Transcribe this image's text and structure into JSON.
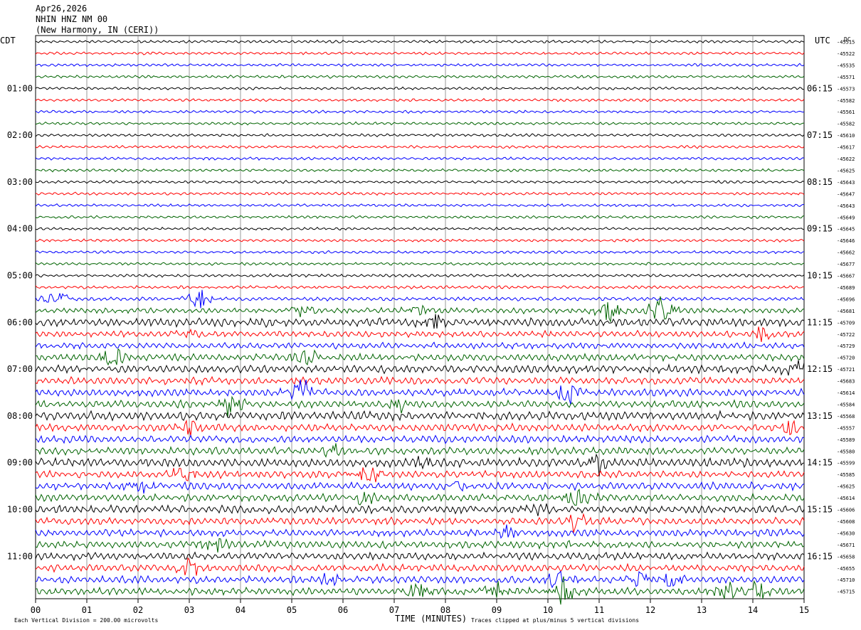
{
  "header": {
    "date": "Apr26,2026",
    "station": "NHIN HNZ NM 00",
    "location": "(New Harmony, IN (CERI))"
  },
  "left_timezone": "CDT",
  "right_timezone": "UTC",
  "corner_tag": "DC",
  "footer": {
    "scale_note": "Each Vertical Division =  200.00 microvolts",
    "xlabel": "TIME (MINUTES)",
    "clip_note": "Traces clipped at plus/minus 5 vertical divisions"
  },
  "colors": {
    "cycle": [
      "#000000",
      "#ff0000",
      "#0000ff",
      "#006400"
    ],
    "grid": "#808080"
  },
  "chart_data": {
    "type": "helicorder",
    "xlabel": "TIME (MINUTES)",
    "xlim": [
      0,
      15
    ],
    "x_ticks": [
      "00",
      "01",
      "02",
      "03",
      "04",
      "05",
      "06",
      "07",
      "08",
      "09",
      "10",
      "11",
      "12",
      "13",
      "14",
      "15"
    ],
    "grid": true,
    "row_minutes": 15,
    "row_count": 48,
    "left_hour_labels": [
      {
        "row": 4,
        "label": "01:00"
      },
      {
        "row": 8,
        "label": "02:00"
      },
      {
        "row": 12,
        "label": "03:00"
      },
      {
        "row": 16,
        "label": "04:00"
      },
      {
        "row": 20,
        "label": "05:00"
      },
      {
        "row": 24,
        "label": "06:00"
      },
      {
        "row": 28,
        "label": "07:00"
      },
      {
        "row": 32,
        "label": "08:00"
      },
      {
        "row": 36,
        "label": "09:00"
      },
      {
        "row": 40,
        "label": "10:00"
      },
      {
        "row": 44,
        "label": "11:00"
      }
    ],
    "right_hour_labels": [
      {
        "row": 4,
        "label": "06:15"
      },
      {
        "row": 8,
        "label": "07:15"
      },
      {
        "row": 12,
        "label": "08:15"
      },
      {
        "row": 16,
        "label": "09:15"
      },
      {
        "row": 20,
        "label": "10:15"
      },
      {
        "row": 24,
        "label": "11:15"
      },
      {
        "row": 28,
        "label": "12:15"
      },
      {
        "row": 32,
        "label": "13:15"
      },
      {
        "row": 36,
        "label": "14:15"
      },
      {
        "row": 40,
        "label": "15:15"
      },
      {
        "row": 44,
        "label": "16:15"
      }
    ],
    "row_offsets": [
      "-45515",
      "-45522",
      "-45535",
      "-45571",
      "-45573",
      "-45582",
      "-45561",
      "-45582",
      "-45610",
      "-45617",
      "-45622",
      "-45625",
      "-45643",
      "-45647",
      "-45643",
      "-45649",
      "-45645",
      "-45646",
      "-45662",
      "-45677",
      "-45667",
      "-45689",
      "-45696",
      "-45681",
      "-45709",
      "-45722",
      "-45729",
      "-45720",
      "-45721",
      "-45683",
      "-45614",
      "-45584",
      "-45568",
      "-45557",
      "-45589",
      "-45580",
      "-45599",
      "-45585",
      "-45625",
      "-45614",
      "-45606",
      "-45608",
      "-45630",
      "-45671",
      "-45658",
      "-45655",
      "-45710",
      "-45715"
    ],
    "row_noise": [
      0.45,
      0.45,
      0.45,
      0.45,
      0.45,
      0.45,
      0.45,
      0.45,
      0.45,
      0.45,
      0.45,
      0.45,
      0.45,
      0.45,
      0.45,
      0.45,
      0.45,
      0.45,
      0.45,
      0.45,
      0.5,
      0.5,
      0.6,
      0.9,
      1.4,
      1.0,
      1.0,
      1.1,
      1.3,
      1.2,
      1.2,
      1.2,
      1.4,
      1.2,
      1.2,
      1.2,
      1.4,
      1.2,
      1.2,
      1.2,
      1.3,
      1.2,
      1.2,
      1.2,
      1.2,
      1.2,
      1.2,
      1.2
    ],
    "bursts": [
      {
        "row": 22,
        "minute": 0.4,
        "amp": 5
      },
      {
        "row": 22,
        "minute": 3.2,
        "amp": 6
      },
      {
        "row": 23,
        "minute": 5.2,
        "amp": 4
      },
      {
        "row": 23,
        "minute": 7.5,
        "amp": 5
      },
      {
        "row": 23,
        "minute": 11.2,
        "amp": 7
      },
      {
        "row": 23,
        "minute": 12.2,
        "amp": 8
      },
      {
        "row": 24,
        "minute": 7.8,
        "amp": 5
      },
      {
        "row": 25,
        "minute": 3.0,
        "amp": 4
      },
      {
        "row": 25,
        "minute": 14.2,
        "amp": 4
      },
      {
        "row": 27,
        "minute": 1.5,
        "amp": 5
      },
      {
        "row": 27,
        "minute": 5.3,
        "amp": 5
      },
      {
        "row": 28,
        "minute": 14.8,
        "amp": 6
      },
      {
        "row": 30,
        "minute": 5.2,
        "amp": 7
      },
      {
        "row": 30,
        "minute": 10.4,
        "amp": 6
      },
      {
        "row": 31,
        "minute": 3.8,
        "amp": 6
      },
      {
        "row": 31,
        "minute": 7.1,
        "amp": 4
      },
      {
        "row": 33,
        "minute": 3.0,
        "amp": 5
      },
      {
        "row": 33,
        "minute": 14.7,
        "amp": 4
      },
      {
        "row": 35,
        "minute": 5.8,
        "amp": 4
      },
      {
        "row": 36,
        "minute": 11.0,
        "amp": 6
      },
      {
        "row": 36,
        "minute": 7.6,
        "amp": 4
      },
      {
        "row": 37,
        "minute": 6.5,
        "amp": 7
      },
      {
        "row": 37,
        "minute": 2.9,
        "amp": 5
      },
      {
        "row": 38,
        "minute": 2.0,
        "amp": 5
      },
      {
        "row": 38,
        "minute": 8.2,
        "amp": 4
      },
      {
        "row": 39,
        "minute": 10.6,
        "amp": 5
      },
      {
        "row": 39,
        "minute": 6.4,
        "amp": 4
      },
      {
        "row": 40,
        "minute": 9.8,
        "amp": 4
      },
      {
        "row": 41,
        "minute": 10.5,
        "amp": 5
      },
      {
        "row": 42,
        "minute": 9.2,
        "amp": 5
      },
      {
        "row": 43,
        "minute": 3.5,
        "amp": 5
      },
      {
        "row": 45,
        "minute": 3.0,
        "amp": 5
      },
      {
        "row": 46,
        "minute": 5.8,
        "amp": 3
      },
      {
        "row": 46,
        "minute": 10.2,
        "amp": 6
      },
      {
        "row": 46,
        "minute": 11.8,
        "amp": 4
      },
      {
        "row": 46,
        "minute": 12.4,
        "amp": 4
      },
      {
        "row": 47,
        "minute": 7.5,
        "amp": 6
      },
      {
        "row": 47,
        "minute": 9.0,
        "amp": 5
      },
      {
        "row": 47,
        "minute": 10.3,
        "amp": 8
      },
      {
        "row": 47,
        "minute": 13.5,
        "amp": 7
      },
      {
        "row": 47,
        "minute": 14.1,
        "amp": 5
      }
    ]
  }
}
